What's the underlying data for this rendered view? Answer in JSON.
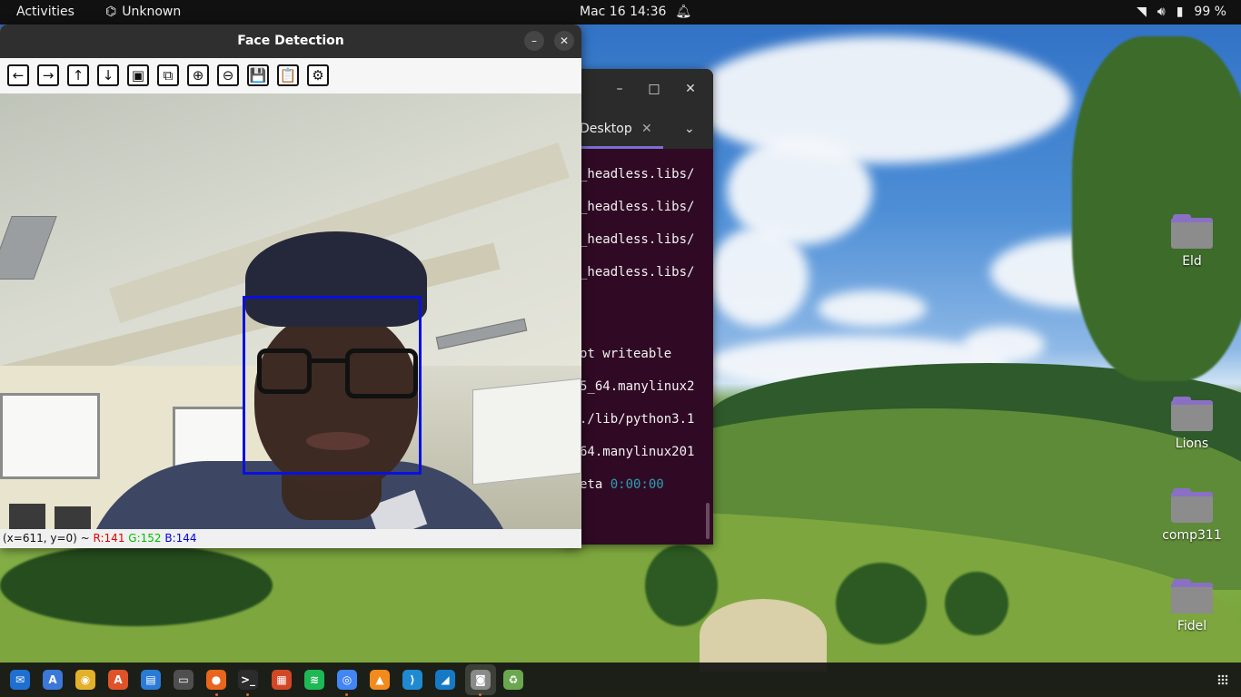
{
  "topbar": {
    "activities": "Activities",
    "indicator_label": "Unknown",
    "datetime": "Mac 16  14:36",
    "battery": "99 %"
  },
  "terminal": {
    "tab_label": "Desktop",
    "lines": [
      "_headless.libs/",
      "_headless.libs/",
      "_headless.libs/",
      "_headless.libs/",
      "ot writeable",
      "5_64.manylinux2",
      "./lib/python3.1",
      "64.manylinux201"
    ],
    "eta_prefix": "eta ",
    "eta_value": "0:00:00"
  },
  "face_window": {
    "title": "Face Detection",
    "minimize": "–",
    "close": "✕",
    "toolbar": [
      {
        "name": "pan-left-button",
        "glyph": "←"
      },
      {
        "name": "pan-right-button",
        "glyph": "→"
      },
      {
        "name": "pan-up-button",
        "glyph": "↑"
      },
      {
        "name": "pan-down-button",
        "glyph": "↓"
      },
      {
        "name": "zoom-reset-button",
        "glyph": "▣"
      },
      {
        "name": "zoom-fit-button",
        "glyph": "⧉"
      },
      {
        "name": "zoom-in-button",
        "glyph": "⊕"
      },
      {
        "name": "zoom-out-button",
        "glyph": "⊖"
      },
      {
        "name": "save-button",
        "glyph": "💾"
      },
      {
        "name": "copy-button",
        "glyph": "📋"
      },
      {
        "name": "properties-button",
        "glyph": "⚙"
      }
    ],
    "status_coords": "(x=611, y=0) ~ ",
    "status_r": "R:141",
    "status_g": "G:152",
    "status_b": "B:144"
  },
  "desktop_icons": [
    {
      "label": "Eld"
    },
    {
      "label": "Lions"
    },
    {
      "label": "comp311"
    },
    {
      "label": "Fidel"
    }
  ],
  "dock": {
    "apps": [
      {
        "name": "thunderbird-icon",
        "color": "#1f6fd1",
        "glyph": "✉"
      },
      {
        "name": "translate-icon",
        "color": "#3c78d8",
        "glyph": "A"
      },
      {
        "name": "rhythmbox-icon",
        "color": "#e3b02a",
        "glyph": "◉"
      },
      {
        "name": "software-icon",
        "color": "#e0532a",
        "glyph": "A"
      },
      {
        "name": "writer-icon",
        "color": "#2a7ad6",
        "glyph": "▤"
      },
      {
        "name": "files-icon",
        "color": "#4f4f4f",
        "glyph": "▭"
      },
      {
        "name": "firefox-icon",
        "color": "#e8661d",
        "glyph": "●"
      },
      {
        "name": "terminal-icon",
        "color": "#2c2c2c",
        "glyph": ">_"
      },
      {
        "name": "impress-icon",
        "color": "#d24726",
        "glyph": "▦"
      },
      {
        "name": "spotify-icon",
        "color": "#1db954",
        "glyph": "≋"
      },
      {
        "name": "chrome-icon",
        "color": "#4285f4",
        "glyph": "◎"
      },
      {
        "name": "vlc-icon",
        "color": "#f28a1c",
        "glyph": "▲"
      },
      {
        "name": "vscode-icon",
        "color": "#1f8ad2",
        "glyph": "⟩"
      },
      {
        "name": "wireshark-icon",
        "color": "#1679c6",
        "glyph": "◢"
      },
      {
        "name": "face-detection-app-icon",
        "color": "#8a8a8a",
        "glyph": "◙"
      },
      {
        "name": "trash-icon",
        "color": "#6aa84f",
        "glyph": "♻"
      }
    ]
  }
}
